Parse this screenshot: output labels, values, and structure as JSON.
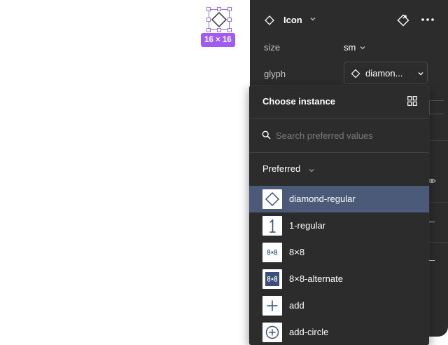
{
  "canvas": {
    "size_badge": "16 × 16"
  },
  "panel": {
    "component_name": "Icon",
    "props": [
      {
        "label": "size",
        "value": "sm"
      },
      {
        "label": "glyph",
        "value": "diamon..."
      }
    ]
  },
  "popover": {
    "title": "Choose instance",
    "search_placeholder": "Search preferred values",
    "section_label": "Preferred",
    "items": [
      {
        "label": "diamond-regular",
        "icon": "diamond-icon",
        "selected": true
      },
      {
        "label": "1-regular",
        "icon": "digit-one-icon"
      },
      {
        "label": "8×8",
        "icon": "8x8-icon"
      },
      {
        "label": "8×8-alternate",
        "icon": "8x8-alternate-icon"
      },
      {
        "label": "add",
        "icon": "plus-icon"
      },
      {
        "label": "add-circle",
        "icon": "plus-circle-icon"
      }
    ]
  },
  "colors": {
    "selection": "#9a6ce8",
    "badge": "#a05cf0",
    "panel_bg": "#2c2c2c",
    "selected_row": "#4c5a7a"
  }
}
